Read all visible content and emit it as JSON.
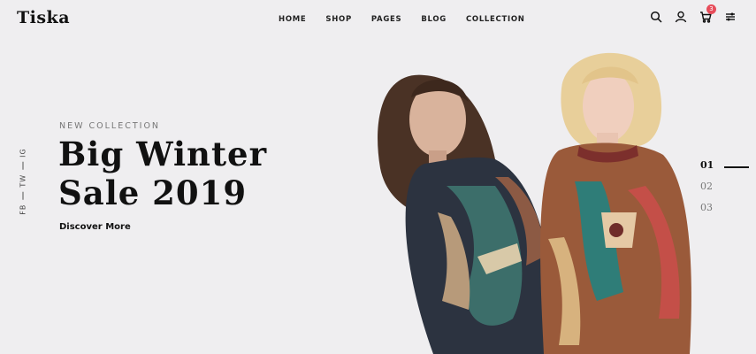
{
  "header": {
    "logo": "Tiska",
    "nav": [
      "HOME",
      "SHOP",
      "PAGES",
      "BLOG",
      "COLLECTION"
    ],
    "icons": [
      "search-icon",
      "user-icon",
      "cart-icon",
      "menu-lines-icon"
    ],
    "cart_count": "3"
  },
  "social": [
    "FB",
    "TW",
    "IG"
  ],
  "hero": {
    "subtitle": "NEW COLLECTION",
    "title_line1": "Big Winter",
    "title_line2": "Sale 2019",
    "cta": "Discover More"
  },
  "slider": {
    "slides": [
      "01",
      "02",
      "03"
    ],
    "active": "01"
  },
  "colors": {
    "background": "#efeef0",
    "text": "#111111",
    "badge": "#e74c5a",
    "sweater_dark": "#2c3340",
    "sweater_warm": "#9a5a3a"
  }
}
